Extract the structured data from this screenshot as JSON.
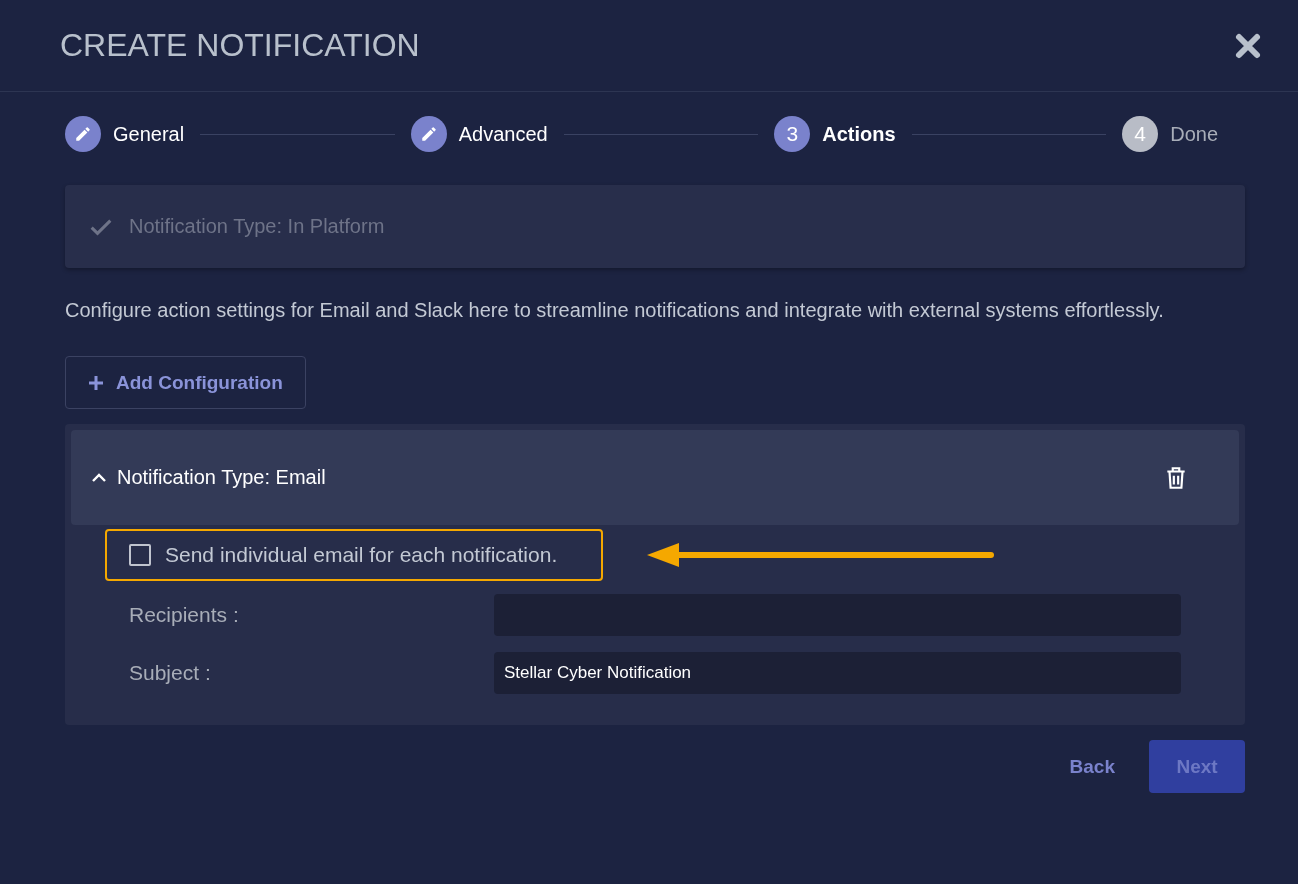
{
  "dialog": {
    "title": "CREATE NOTIFICATION"
  },
  "steps": [
    {
      "label": "General",
      "kind": "done"
    },
    {
      "label": "Advanced",
      "kind": "done"
    },
    {
      "label": "Actions",
      "kind": "active",
      "number": "3"
    },
    {
      "label": "Done",
      "kind": "pending",
      "number": "4"
    }
  ],
  "collapsed_section": {
    "title": "Notification Type: In Platform",
    "complete": true
  },
  "description": "Configure action settings for Email and Slack here to streamline notifications and integrate with external systems effortlessly.",
  "add_button": {
    "label": "Add Configuration"
  },
  "email_section": {
    "title": "Notification Type: Email",
    "expanded": true,
    "checkbox": {
      "label": "Send individual email for each notification.",
      "checked": false,
      "highlighted": true
    },
    "fields": [
      {
        "label": "Recipients :"
      },
      {
        "label": "Subject :",
        "value": "Stellar Cyber Notification"
      }
    ]
  },
  "footer": {
    "back": "Back",
    "next": {
      "label": "Next",
      "disabled": true
    }
  }
}
